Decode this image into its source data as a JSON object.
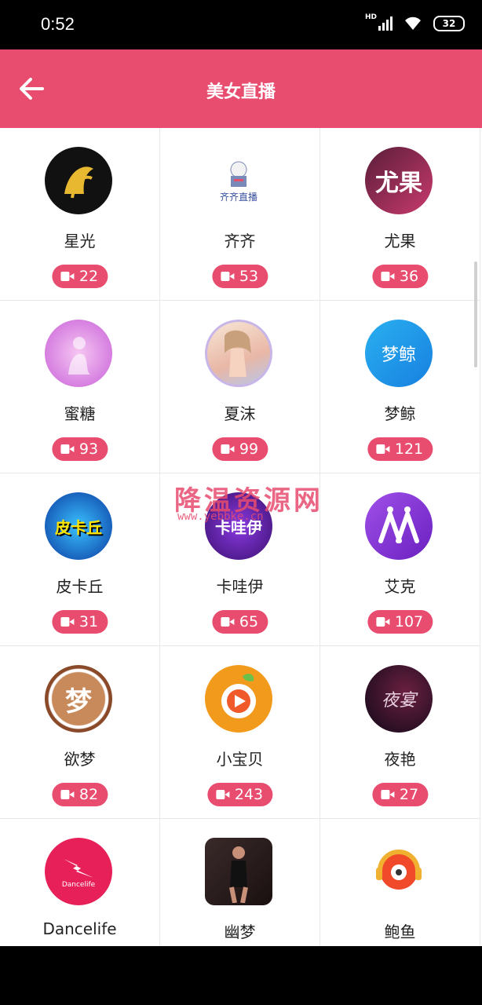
{
  "status": {
    "time": "0:52",
    "network": "HD",
    "battery": "32"
  },
  "header": {
    "title": "美女直播"
  },
  "platforms": [
    {
      "name": "星光",
      "count": "22"
    },
    {
      "name": "齐齐",
      "count": "53"
    },
    {
      "name": "尤果",
      "count": "36"
    },
    {
      "name": "蜜糖",
      "count": "93"
    },
    {
      "name": "夏沫",
      "count": "99"
    },
    {
      "name": "梦鲸",
      "count": "121"
    },
    {
      "name": "皮卡丘",
      "count": "31"
    },
    {
      "name": "卡哇伊",
      "count": "65"
    },
    {
      "name": "艾克",
      "count": "107"
    },
    {
      "name": "欲梦",
      "count": "82"
    },
    {
      "name": "小宝贝",
      "count": "243"
    },
    {
      "name": "夜艳",
      "count": "27"
    },
    {
      "name": "Dancelife",
      "count": ""
    },
    {
      "name": "幽梦",
      "count": ""
    },
    {
      "name": "鲍鱼",
      "count": ""
    }
  ],
  "logos": {
    "xingguang": "",
    "qiqi": "齐齐直播",
    "youguo": "尤果",
    "mitang": "",
    "xiamo": "",
    "mengjing": "梦鲸",
    "pikaqiu": "皮卡丘",
    "kawayi": "卡哇伊",
    "aike": "",
    "yumeng": "梦",
    "xiaobaobei": "",
    "yeyan": "夜宴",
    "dancelife": "Dancelife",
    "youmeng": "",
    "baoyu": ""
  },
  "watermark": {
    "text": "降温资源网",
    "url": "www.yebbke.cn"
  },
  "colors": {
    "accent": "#e84c6f",
    "background": "#ffffff"
  }
}
